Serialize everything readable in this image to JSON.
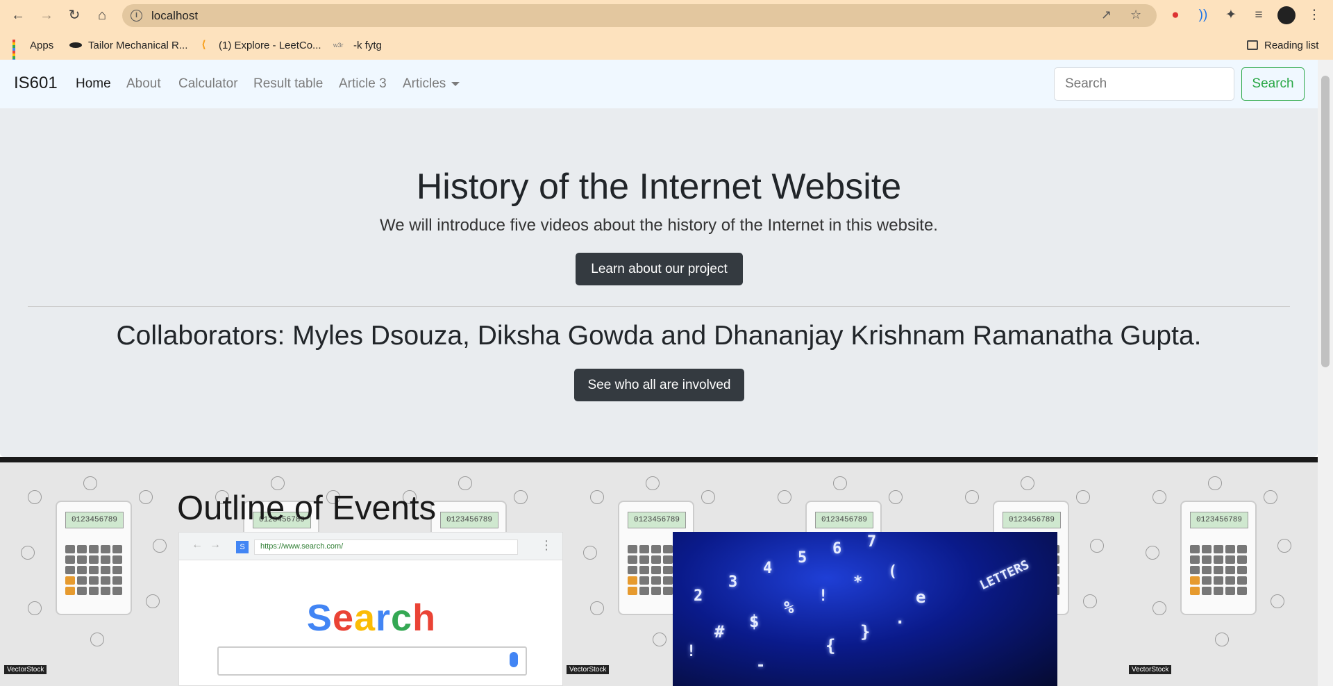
{
  "browser": {
    "url": "localhost",
    "bookmarks": [
      {
        "label": "Apps"
      },
      {
        "label": "Tailor Mechanical R..."
      },
      {
        "label": "(1) Explore - LeetCo..."
      },
      {
        "label": "-k fytg",
        "icon_text": "w3r"
      }
    ],
    "reading_list": "Reading list"
  },
  "navbar": {
    "brand": "IS601",
    "links": [
      "Home",
      "About",
      "Calculator",
      "Result table",
      "Article 3",
      "Articles"
    ],
    "search_placeholder": "Search",
    "search_button": "Search"
  },
  "hero": {
    "title": "History of the Internet Website",
    "lead": "We will introduce five videos about the history of the Internet in this website.",
    "project_button": "Learn about our project",
    "collaborators": "Collaborators: Myles Dsouza, Diksha Gowda and Dhananjay Krishnam Ramanatha Gupta.",
    "involved_button": "See who all are involved"
  },
  "outline": {
    "title": "Outline of Events",
    "image1_url": "https://www.search.com/",
    "image1_word": "Search",
    "image2_word": "LETTERS"
  },
  "background_tile": {
    "display": "0123456789",
    "watermark": "VectorStock"
  },
  "colors": {
    "chrome_bg": "#fde2be",
    "navbar_bg": "#f0f8ff",
    "jumbotron_bg": "#e9ecef",
    "dark_button": "#343a40",
    "success": "#28a745"
  }
}
